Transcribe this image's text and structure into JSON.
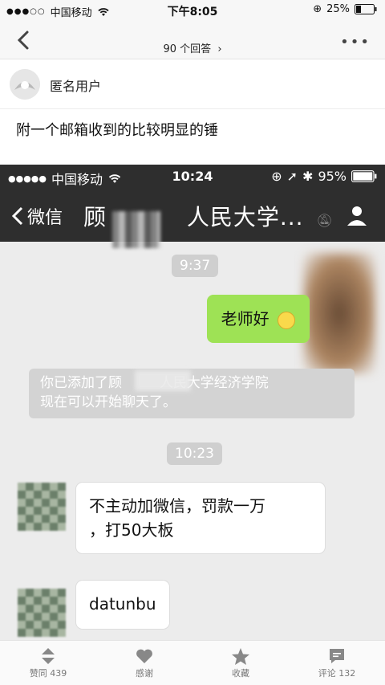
{
  "status_bar": {
    "carrier": "中国移动",
    "time": "下午8:05",
    "battery": "25%"
  },
  "nav": {
    "title": "90 个回答"
  },
  "author": {
    "name": "匿名用户"
  },
  "answer": {
    "text": "附一个邮箱收到的比较明显的锤"
  },
  "screenshot": {
    "status": {
      "carrier": "中国移动",
      "time": "10:24",
      "battery": "95%"
    },
    "nav": {
      "back_label": "微信",
      "title": "顾",
      "title_suffix": "人民大学..."
    },
    "messages": {
      "time1": "9:37",
      "outgoing": "老师好",
      "system_line1_a": "你已添加了顾",
      "system_line1_b": "人民大学经济学院",
      "system_line2": "现在可以开始聊天了。",
      "time2": "10:23",
      "incoming1_line1": "不主动加微信，罚款一万",
      "incoming1_line2": "，打50大板",
      "incoming2": "datunbu"
    }
  },
  "bottom_bar": {
    "vote": "赞同 439",
    "thanks": "感谢",
    "collect": "收藏",
    "comments": "评论 132"
  },
  "colors": {
    "green_bubble": "#9ee255",
    "wechat_bar": "#2e2e2e",
    "chat_bg": "#ececec"
  }
}
